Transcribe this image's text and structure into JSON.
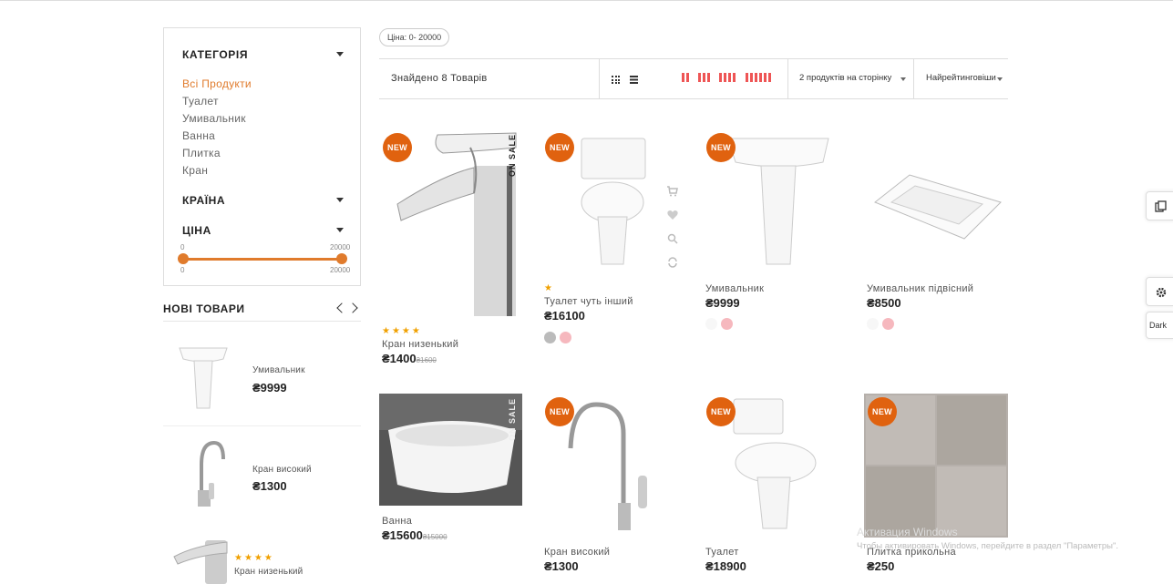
{
  "sidebar": {
    "category_title": "КАТЕГОРІЯ",
    "categories": [
      "Всі Продукти",
      "Туалет",
      "Умивальник",
      "Ванна",
      "Плитка",
      "Кран"
    ],
    "country_title": "КРАЇНА",
    "price_title": "ЦІНА",
    "price_range": {
      "min_top": "0",
      "max_top": "20000",
      "min_bottom": "0",
      "max_bottom": "20000"
    },
    "new_products_title": "НОВІ ТОВАРИ",
    "new_products": [
      {
        "name": "Умивальник",
        "price": "₴9999",
        "rating": ""
      },
      {
        "name": "Кран високий",
        "price": "₴1300",
        "rating": ""
      },
      {
        "name": "Кран низенький",
        "price": "",
        "rating": "★★★★"
      }
    ]
  },
  "toolbar": {
    "price_chip": "Ціна: 0- 20000",
    "found": "Знайдено 8 Товарів",
    "per_page": "2 продуктів на сторінку",
    "sort": "Найрейтинговіши"
  },
  "products": [
    {
      "name": "Кран низенький",
      "price": "₴1400",
      "old_price": "₴1600",
      "badge": "NEW",
      "on_sale": "ON SALE",
      "rating": "★★★★",
      "swatches": []
    },
    {
      "name": "Туалет чуть інший",
      "price": "₴16100",
      "old_price": "",
      "badge": "NEW",
      "on_sale": "",
      "rating": "★",
      "swatches": [
        "#bbbbbb",
        "#f6b8be"
      ]
    },
    {
      "name": "Умивальник",
      "price": "₴9999",
      "old_price": "",
      "badge": "NEW",
      "on_sale": "",
      "rating": "",
      "swatches": [
        "#f7f7f7",
        "#f6b8be"
      ]
    },
    {
      "name": "Умивальник підвісний",
      "price": "₴8500",
      "old_price": "",
      "badge": "",
      "on_sale": "",
      "rating": "",
      "swatches": [
        "#f7f7f7",
        "#f6b8be"
      ]
    },
    {
      "name": "Ванна",
      "price": "₴15600",
      "old_price": "₴15000",
      "badge": "",
      "on_sale": "ON SALE",
      "rating": "",
      "swatches": []
    },
    {
      "name": "Кран високий",
      "price": "₴1300",
      "old_price": "",
      "badge": "NEW",
      "on_sale": "",
      "rating": "",
      "swatches": []
    },
    {
      "name": "Туалет",
      "price": "₴18900",
      "old_price": "",
      "badge": "NEW",
      "on_sale": "",
      "rating": "",
      "swatches": []
    },
    {
      "name": "Плитка прикольна",
      "price": "₴250",
      "old_price": "",
      "badge": "NEW",
      "on_sale": "",
      "rating": "",
      "swatches": []
    }
  ],
  "right_tools": {
    "dark_label": "Dark"
  },
  "watermark": {
    "line1": "Активация Windows",
    "line2": "Чтобы активировать Windows, перейдите в раздел \"Параметры\"."
  },
  "colors": {
    "accent": "#e07b2c",
    "badge": "#e0620f",
    "grid_active": "#ee5555"
  }
}
